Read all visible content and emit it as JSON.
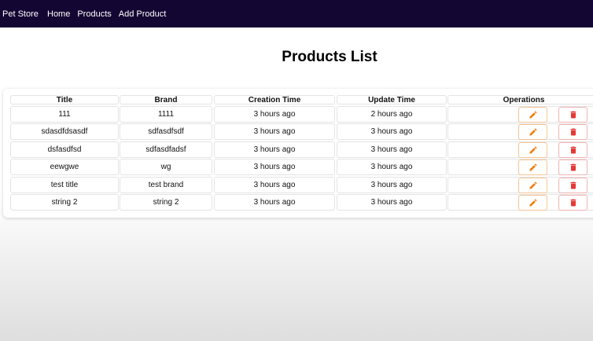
{
  "navbar": {
    "brand": "Pet Store",
    "links": [
      "Home",
      "Products",
      "Add Product"
    ]
  },
  "page": {
    "title": "Products List"
  },
  "table": {
    "headers": {
      "title": "Title",
      "brand": "Brand",
      "creation": "Creation Time",
      "update": "Update Time",
      "operations": "Operations"
    },
    "rows": [
      {
        "title": "111",
        "brand": "1111",
        "creation": "3 hours ago",
        "update": "2 hours ago"
      },
      {
        "title": "sdasdfdsasdf",
        "brand": "sdfasdfsdf",
        "creation": "3 hours ago",
        "update": "3 hours ago"
      },
      {
        "title": "dsfasdfsd",
        "brand": "sdfasdfadsf",
        "creation": "3 hours ago",
        "update": "3 hours ago"
      },
      {
        "title": "eewgwe",
        "brand": "wg",
        "creation": "3 hours ago",
        "update": "3 hours ago"
      },
      {
        "title": "test title",
        "brand": "test brand",
        "creation": "3 hours ago",
        "update": "3 hours ago"
      },
      {
        "title": "string 2",
        "brand": "string 2",
        "creation": "3 hours ago",
        "update": "3 hours ago"
      }
    ]
  },
  "colors": {
    "navbar_bg": "#140633",
    "edit_icon": "#f07f10",
    "delete_icon": "#e53935"
  },
  "icons": {
    "edit": "pencil-icon",
    "delete": "trash-icon"
  }
}
